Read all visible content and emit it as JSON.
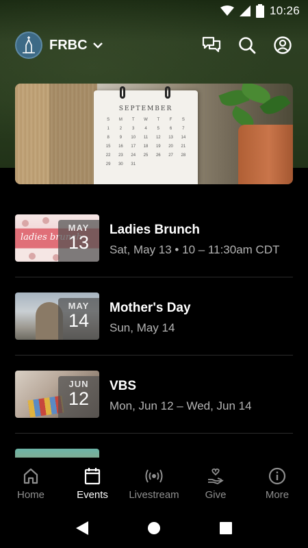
{
  "status_bar": {
    "time": "10:26"
  },
  "app_bar": {
    "org_name": "FRBC"
  },
  "hero": {
    "calendar_month": "SEPTEMBER",
    "calendar_weekdays": [
      "S",
      "M",
      "T",
      "W",
      "T",
      "F",
      "S"
    ]
  },
  "events": [
    {
      "month": "MAY",
      "day": "13",
      "title": "Ladies Brunch",
      "subtitle": "Sat, May 13 • 10 – 11:30am CDT",
      "thumb_text": "ladies brunch"
    },
    {
      "month": "MAY",
      "day": "14",
      "title": "Mother's Day",
      "subtitle": "Sun, May 14"
    },
    {
      "month": "JUN",
      "day": "12",
      "title": "VBS",
      "subtitle": "Mon, Jun 12 – Wed, Jun 14"
    }
  ],
  "bottom_nav": {
    "items": [
      {
        "label": "Home",
        "icon": "home-icon",
        "active": false
      },
      {
        "label": "Events",
        "icon": "calendar-icon",
        "active": true
      },
      {
        "label": "Livestream",
        "icon": "broadcast-icon",
        "active": false
      },
      {
        "label": "Give",
        "icon": "give-heart-hand-icon",
        "active": false
      },
      {
        "label": "More",
        "icon": "info-icon",
        "active": false
      }
    ]
  },
  "colors": {
    "accent": "#ffffff",
    "inactive": "#8f8f8f",
    "header_green": "#2d3f22"
  }
}
